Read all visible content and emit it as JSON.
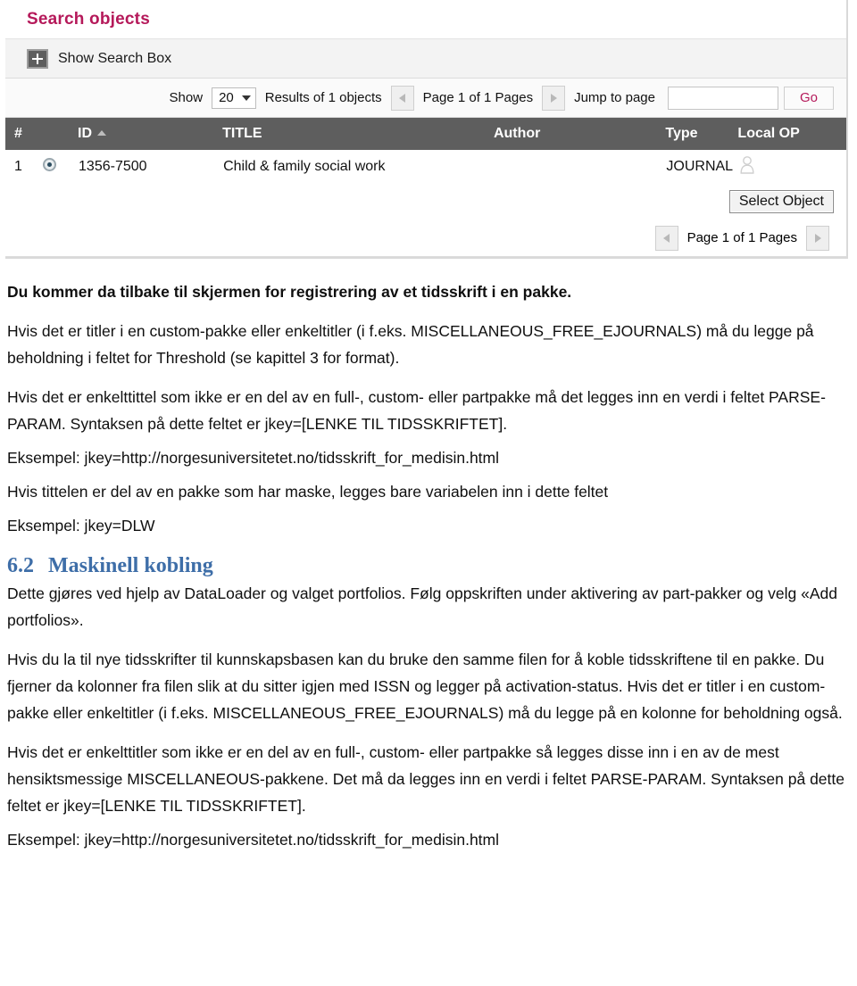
{
  "screenshot": {
    "title": "Search objects",
    "search_toggle_label": "Show Search Box",
    "toolbar": {
      "show_label": "Show",
      "page_size_value": "20",
      "results_label": "Results of 1 objects",
      "page_status": "Page 1 of 1 Pages",
      "jump_label": "Jump to page",
      "jump_value": "",
      "jump_placeholder": "",
      "go_label": "Go"
    },
    "table": {
      "columns": [
        "#",
        "",
        "ID",
        "TITLE",
        "Author",
        "Type",
        "Local OP"
      ],
      "rows": [
        {
          "num": "1",
          "selected": true,
          "id": "1356-7500",
          "title": "Child & family social work",
          "author": "",
          "type": "JOURNAL",
          "local_op": "person-icon"
        }
      ]
    },
    "select_object_label": "Select Object",
    "footer_page_status": "Page 1 of 1 Pages",
    "colors": {
      "title_crimson": "#b5195a",
      "header_gray": "#5e5e5e",
      "link_blue": "#6b8fb0",
      "heading_blue": "#3e6ea8"
    }
  },
  "document": {
    "para_1": "Du kommer da tilbake til skjermen for registrering av et tidsskrift i en pakke.",
    "para_2": "Hvis det er titler i en custom-pakke eller enkeltitler (i f.eks. MISCELLANEOUS_FREE_EJOURNALS) må du legge på beholdning i feltet for Threshold (se kapittel 3 for format).",
    "para_3": "Hvis det er enkelttittel som ikke er en del av en full-, custom- eller partpakke må det legges inn en verdi i feltet PARSE-PARAM. Syntaksen på dette feltet er jkey=[LENKE TIL TIDSSKRIFTET].",
    "para_4": "Eksempel: jkey=http://norgesuniversitetet.no/tidsskrift_for_medisin.html",
    "para_5": "Hvis tittelen er del av en pakke som har maske, legges bare variabelen inn i dette feltet",
    "para_6": "Eksempel: jkey=DLW",
    "heading_number": "6.2",
    "heading_text": "Maskinell kobling",
    "para_7": "Dette gjøres ved hjelp av DataLoader og valget portfolios. Følg oppskriften under aktivering av part-pakker og velg «Add portfolios».",
    "para_8": "Hvis du la til nye tidsskrifter til kunnskapsbasen kan du bruke den samme filen for å koble tidsskriftene til en pakke. Du fjerner da kolonner fra filen slik at du sitter igjen med ISSN og legger på activation-status. Hvis det er titler i en custom-pakke eller enkeltitler (i f.eks. MISCELLANEOUS_FREE_EJOURNALS) må du legge på en kolonne for beholdning også.",
    "para_9": "Hvis det er enkelttitler som ikke er en del av en full-, custom- eller partpakke så legges disse inn i en av de mest hensiktsmessige MISCELLANEOUS-pakkene. Det må da legges inn en verdi i feltet PARSE-PARAM. Syntaksen på dette feltet er jkey=[LENKE TIL TIDSSKRIFTET].",
    "para_10": "Eksempel: jkey=http://norgesuniversitetet.no/tidsskrift_for_medisin.html"
  }
}
